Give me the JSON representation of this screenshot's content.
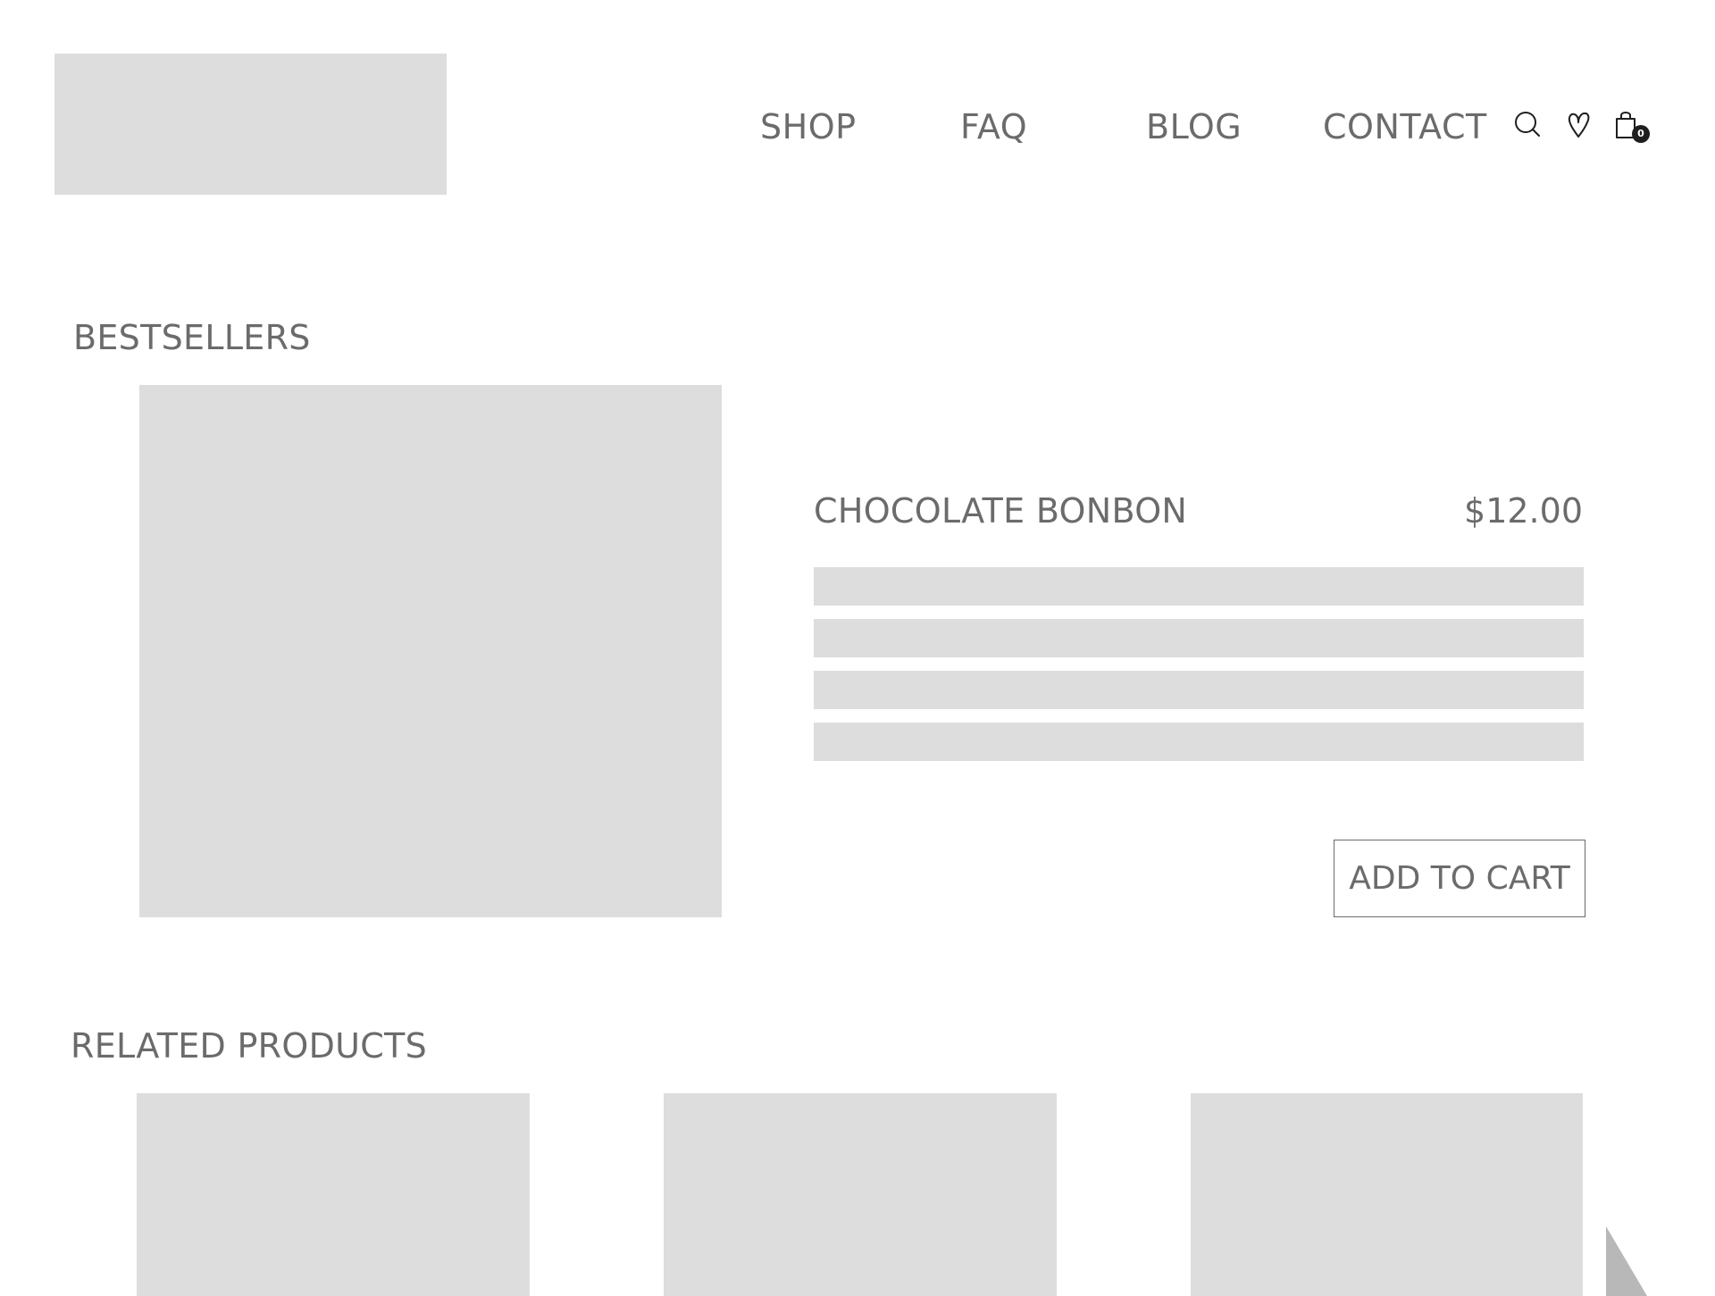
{
  "header": {
    "nav": {
      "shop": "SHOP",
      "faq": "FAQ",
      "blog": "BLOG",
      "contact": "CONTACT"
    },
    "icons": {
      "search": "search-icon",
      "wishlist": "heart-icon",
      "cart": "shopping-bag-icon"
    },
    "cart_count": "0"
  },
  "bestsellers": {
    "title": "BESTSELLERS",
    "product": {
      "name": "CHOCOLATE BONBON",
      "price": "$12.00",
      "add_to_cart_label": "ADD TO CART"
    }
  },
  "related": {
    "title": "RELATED PRODUCTS"
  },
  "colors": {
    "text": "#6b6b6b",
    "placeholder": "#dddddd",
    "badge": "#1e1e1e",
    "corner": "#b8b8b8"
  }
}
